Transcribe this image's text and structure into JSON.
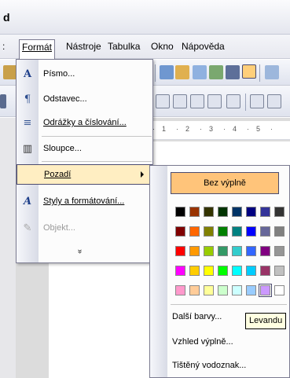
{
  "window": {
    "title": "d"
  },
  "menubar": {
    "items": [
      {
        "label_prefix": ":",
        "label": ""
      },
      {
        "label": "Formát"
      },
      {
        "label": "Nástroje"
      },
      {
        "label": "Tabulka"
      },
      {
        "label": "Okno"
      },
      {
        "label": "Nápověda"
      }
    ]
  },
  "ruler": {
    "ticks": [
      "1",
      "·",
      "2",
      "·",
      "3",
      "·",
      "4",
      "·",
      "5",
      "·"
    ]
  },
  "format_menu": {
    "items": [
      {
        "icon": "A",
        "label": "Písmo..."
      },
      {
        "icon": "¶",
        "label": "Odstavec..."
      },
      {
        "icon": "≡",
        "label": "Odrážky a číslování..."
      },
      {
        "icon": "▥",
        "label": "Sloupce..."
      },
      {
        "icon": "",
        "label": "Pozadí"
      },
      {
        "icon": "A",
        "label": "Styly a formátování..."
      },
      {
        "icon": "✎",
        "label": "Objekt..."
      }
    ],
    "more": "»"
  },
  "background_menu": {
    "no_fill": "Bez výplně",
    "palette": [
      [
        "#000000",
        "#993300",
        "#333300",
        "#003300",
        "#003366",
        "#000080",
        "#333399",
        "#333333"
      ],
      [
        "#800000",
        "#ff6600",
        "#808000",
        "#008000",
        "#008080",
        "#0000ff",
        "#666699",
        "#808080"
      ],
      [
        "#ff0000",
        "#ff9900",
        "#99cc00",
        "#339966",
        "#33cccc",
        "#3366ff",
        "#800080",
        "#969696"
      ],
      [
        "#ff00ff",
        "#ffcc00",
        "#ffff00",
        "#00ff00",
        "#00ffff",
        "#00ccff",
        "#993366",
        "#c0c0c0"
      ],
      [
        "#ff99cc",
        "#ffcc99",
        "#ffff99",
        "#ccffcc",
        "#ccffff",
        "#99ccff",
        "#cc99ff",
        "#ffffff"
      ]
    ],
    "selected_color": "#cc99ff",
    "more_colors": "Další barvy...",
    "fill_effects": "Vzhled výplně...",
    "printed_watermark": "Tištěný vodoznak..."
  },
  "tooltip": {
    "text": "Levandu"
  }
}
